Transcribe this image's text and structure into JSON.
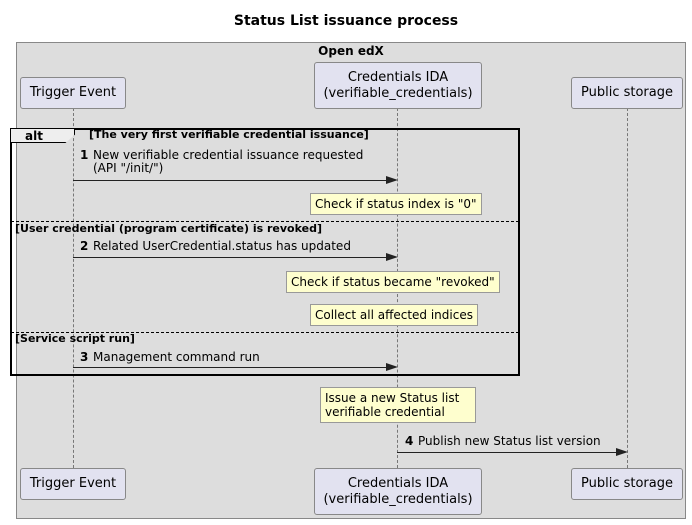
{
  "title": "Status List issuance process",
  "group": {
    "label": "Open edX"
  },
  "participants": [
    {
      "id": "trigger",
      "label": "Trigger Event"
    },
    {
      "id": "ida",
      "label": "Credentials IDA\n(verifiable_credentials)"
    },
    {
      "id": "storage",
      "label": "Public storage"
    }
  ],
  "alt": {
    "keyword": "alt",
    "branches": [
      {
        "guard": "[The very first verifiable credential issuance]"
      },
      {
        "guard": "[User credential (program certificate) is revoked]"
      },
      {
        "guard": "[Service script run]"
      }
    ]
  },
  "messages": [
    {
      "number": "1",
      "text": "New verifiable credential issuance requested\n(API \"/init/\")",
      "from": "Trigger Event",
      "to": "Credentials IDA"
    },
    {
      "number": "2",
      "text": "Related UserCredential.status has updated",
      "from": "Trigger Event",
      "to": "Credentials IDA"
    },
    {
      "number": "3",
      "text": "Management command run",
      "from": "Trigger Event",
      "to": "Credentials IDA"
    },
    {
      "number": "4",
      "text": "Publish new Status list version",
      "from": "Credentials IDA",
      "to": "Public storage"
    }
  ],
  "notes": [
    {
      "text": "Check if status index is \"0\""
    },
    {
      "text": "Check if status became \"revoked\""
    },
    {
      "text": "Collect all affected indices"
    },
    {
      "text": "Issue a new Status list\nverifiable credential"
    }
  ],
  "colors": {
    "participant_fill": "#e2e2f0",
    "group_fill": "#dddddd",
    "note_fill": "#fefece"
  }
}
